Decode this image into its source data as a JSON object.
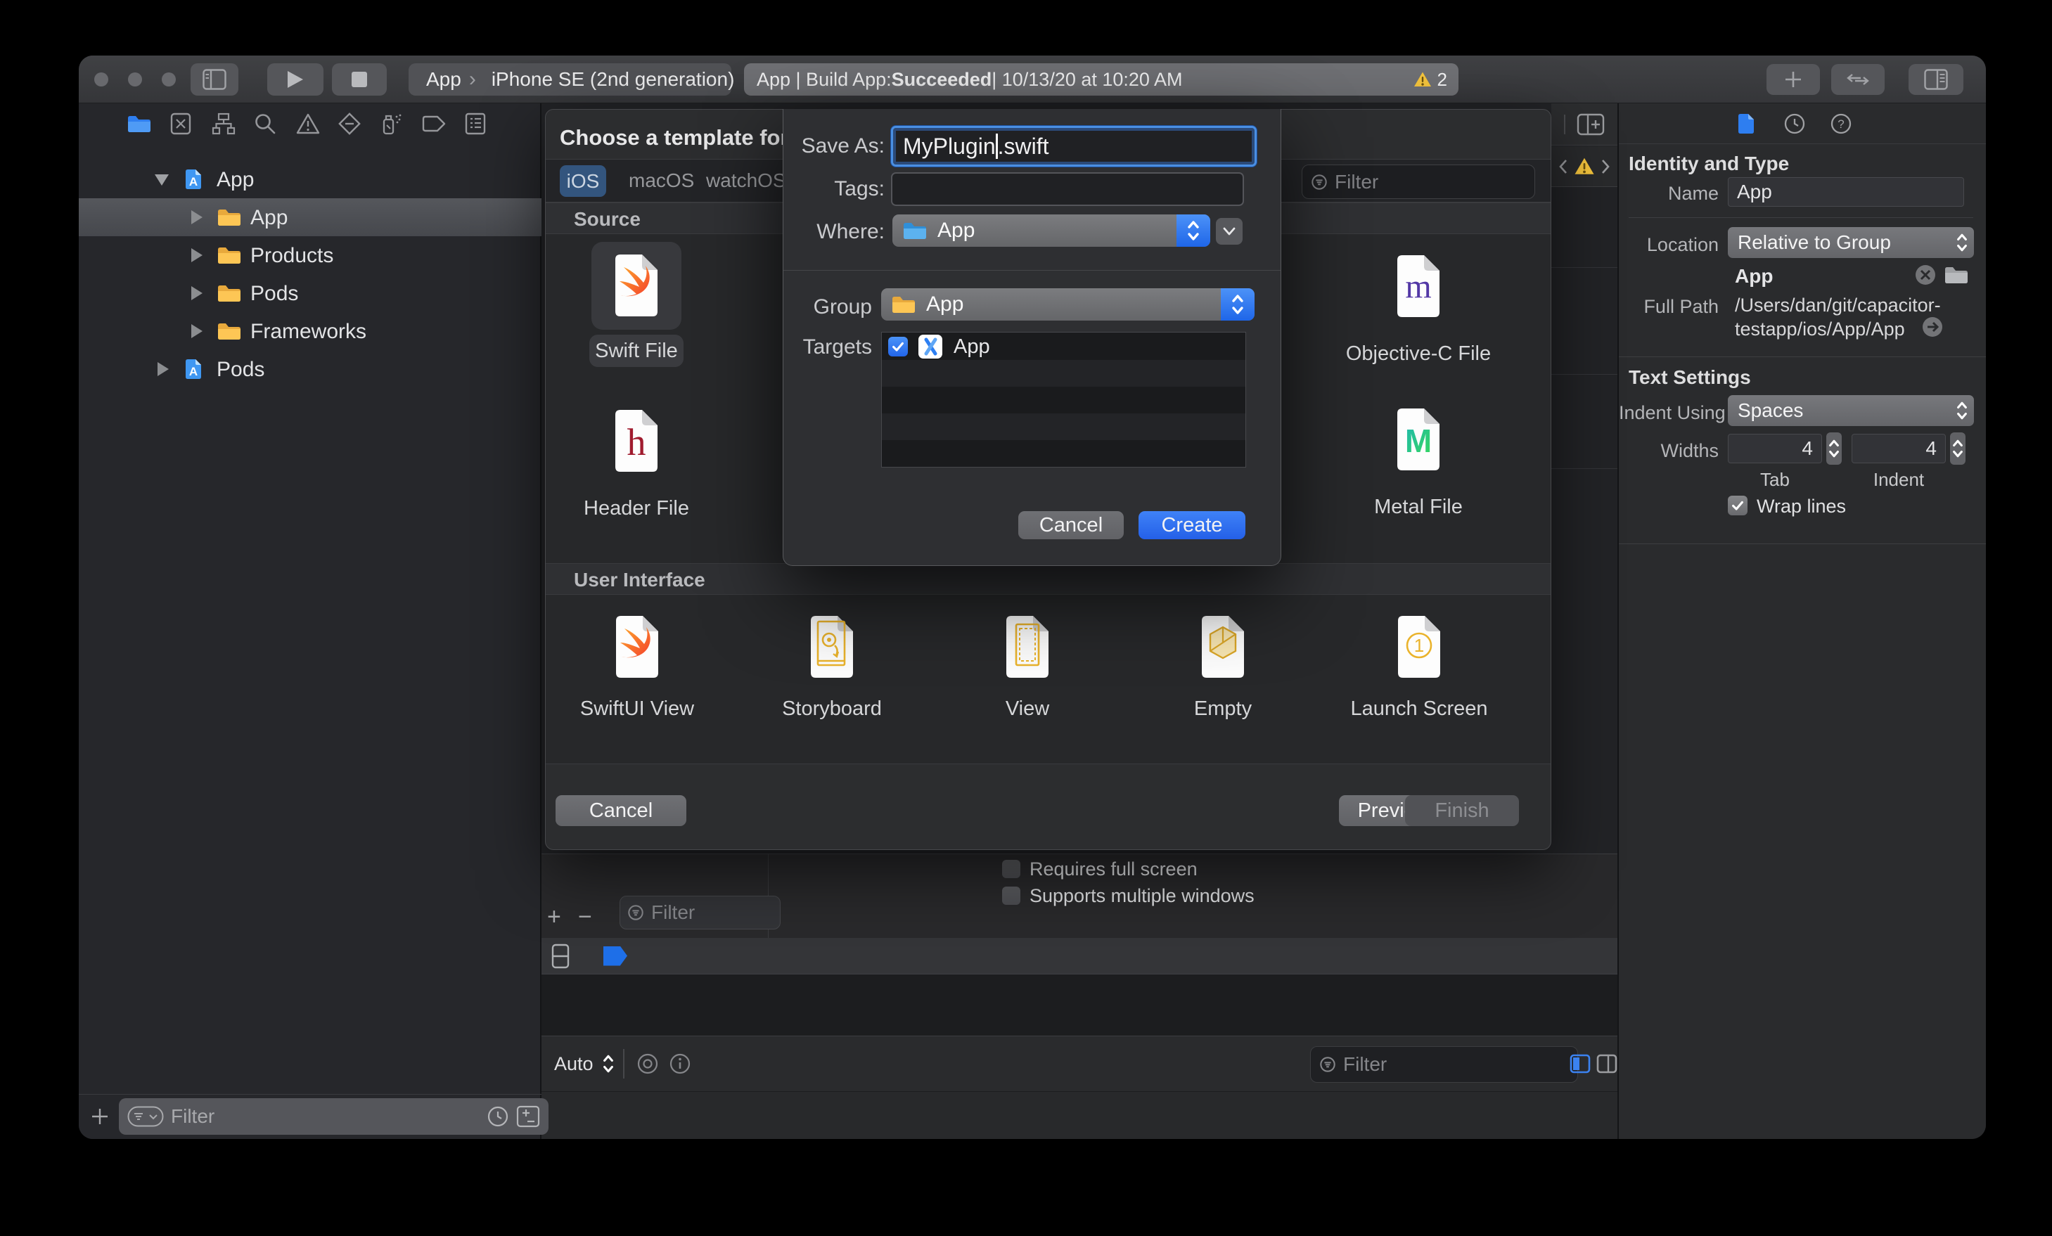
{
  "toolbar": {
    "scheme_app": "App",
    "scheme_sep": "›",
    "scheme_device": "iPhone SE (2nd generation)",
    "status_prefix": "App | Build App: ",
    "status_bold": "Succeeded",
    "status_suffix": " | 10/13/20 at 10:20 AM",
    "warning_count": "2"
  },
  "navigator": {
    "items": [
      {
        "label": "App"
      },
      {
        "label": "App"
      },
      {
        "label": "Products"
      },
      {
        "label": "Pods"
      },
      {
        "label": "Frameworks"
      },
      {
        "label": "Pods"
      }
    ],
    "filter_placeholder": "Filter"
  },
  "dialog": {
    "title": "Choose a template for your",
    "tab_ios": "iOS",
    "tab_macos": "macOS",
    "tab_watchos": "watchOS",
    "filter_placeholder": "Filter",
    "section_source": "Source",
    "section_ui": "User Interface",
    "tpl_swift": "Swift File",
    "tpl_header": "Header File",
    "tpl_objc": "Objective-C File",
    "tpl_metal": "Metal File",
    "tpl_swiftui": "SwiftUI View",
    "tpl_storyboard": "Storyboard",
    "tpl_view": "View",
    "tpl_empty": "Empty",
    "tpl_launch": "Launch Screen",
    "cancel": "Cancel",
    "previous": "Previous",
    "finish": "Finish"
  },
  "sheet": {
    "save_as_label": "Save As:",
    "filename_stem": "MyPlugin",
    "filename_ext": ".swift",
    "tags_label": "Tags:",
    "where_label": "Where:",
    "where_value": "App",
    "group_label": "Group",
    "group_value": "App",
    "targets_label": "Targets",
    "target_name": "App",
    "cancel": "Cancel",
    "create": "Create"
  },
  "editor": {
    "chk_fullscreen": "Requires full screen",
    "chk_multiwindow": "Supports multiple windows",
    "pane_filter_placeholder": "Filter",
    "auto_label": "Auto",
    "bottom_filter_placeholder": "Filter"
  },
  "inspector": {
    "identity_header": "Identity and Type",
    "name_label": "Name",
    "name_value": "App",
    "location_label": "Location",
    "location_value": "Relative to Group",
    "location_file": "App",
    "fullpath_label": "Full Path",
    "fullpath_line1": "/Users/dan/git/capacitor-",
    "fullpath_line2": "testapp/ios/App/App",
    "text_settings_header": "Text Settings",
    "indent_label": "Indent Using",
    "indent_value": "Spaces",
    "widths_label": "Widths",
    "tab_width": "4",
    "indent_width": "4",
    "tab_caption": "Tab",
    "indent_caption": "Indent",
    "wrap_label": "Wrap lines"
  },
  "colors": {
    "accent_blue": "#2e7ef0",
    "create_blue": "#2460e8",
    "folder_yellow": "#fdbc40",
    "warning_yellow": "#f5c53d",
    "selected_tab_blue": "#33557e"
  }
}
